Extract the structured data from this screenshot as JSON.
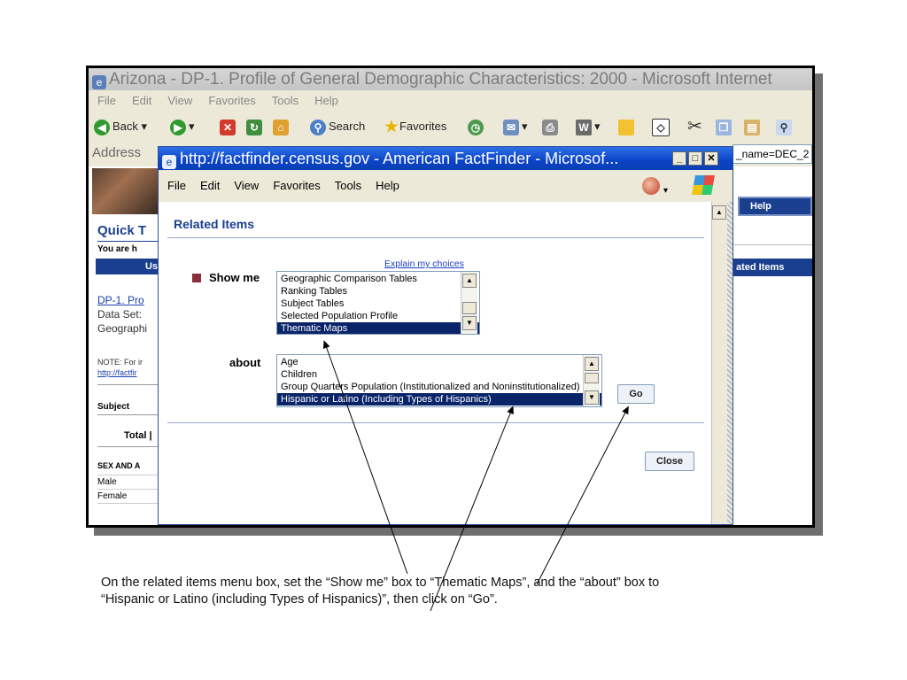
{
  "outer_window": {
    "title": "Arizona - DP-1. Profile of General Demographic Characteristics: 2000 - Microsoft Internet",
    "menu": [
      "File",
      "Edit",
      "View",
      "Favorites",
      "Tools",
      "Help"
    ],
    "toolbar": {
      "back": "Back",
      "search": "Search",
      "favorites": "Favorites"
    },
    "address_label": "Address",
    "address_value": "_name=DEC_2"
  },
  "left_content": {
    "quick_title": "Quick T",
    "you_are_here": "You are h",
    "usd": "Us",
    "dp1_link": "DP-1. Pro",
    "data_set": "Data Set:",
    "geographic": "Geographi",
    "note": "NOTE: For ir",
    "note_link": "http://factfir",
    "subject": "Subject",
    "total": "Total |",
    "sex_and_age": "SEX AND A",
    "male": "Male",
    "female": "Female"
  },
  "right_content": {
    "help": "Help",
    "related_items": "ated Items"
  },
  "popup": {
    "title": "http://factfinder.census.gov - American FactFinder - Microsof...",
    "menu": [
      "File",
      "Edit",
      "View",
      "Favorites",
      "Tools",
      "Help"
    ],
    "heading": "Related Items",
    "explain_link": "Explain my choices",
    "show_me_label": "Show me",
    "show_me_options": [
      "Geographic Comparison Tables",
      "Ranking Tables",
      "Subject Tables",
      "Selected Population Profile",
      "Thematic Maps"
    ],
    "show_me_selected": "Thematic Maps",
    "about_label": "about",
    "about_options": [
      "Age",
      "Children",
      "Group Quarters Population (Institutionalized and Noninstitutionalized)",
      "Hispanic or Latino (Including Types of Hispanics)"
    ],
    "about_selected": "Hispanic or Latino (Including Types of Hispanics)",
    "go_button": "Go",
    "close_button": "Close"
  },
  "caption": {
    "line1": "On the related items menu box, set the “Show me” box to “Thematic Maps”, and the “about” box to",
    "line2": "“Hispanic or Latino (including Types of Hispanics)”, then click on “Go”."
  },
  "colors": {
    "title_bar_blue": "#0b44c8",
    "selection_navy": "#0a246a",
    "section_bar_navy": "#1b3f8f",
    "bullet_maroon": "#8b2f3b"
  }
}
